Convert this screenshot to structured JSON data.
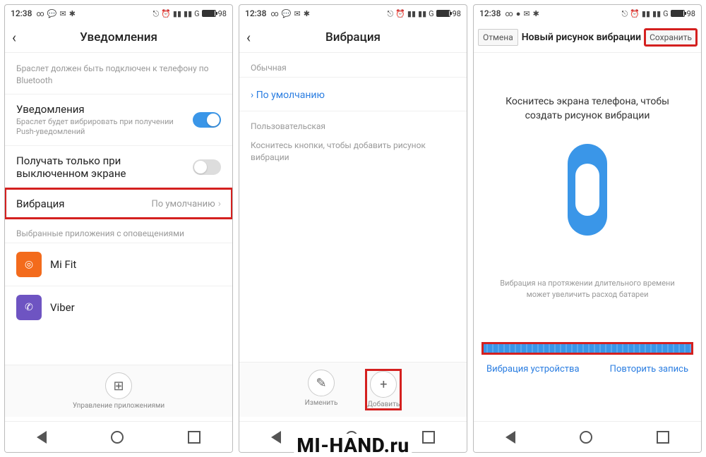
{
  "status": {
    "time": "12:38",
    "battery": "98"
  },
  "screen1": {
    "title": "Уведомления",
    "bt_hint": "Браслет должен быть подключен к телефону по Bluetooth",
    "notif_row": {
      "label": "Уведомления",
      "sub": "Браслет будет вибрировать при получении Push-уведомлений"
    },
    "screen_off_row": {
      "label": "Получать только при выключенном экране"
    },
    "vibration_row": {
      "label": "Вибрация",
      "value": "По умолчанию"
    },
    "apps_header": "Выбранные приложения с оповещениями",
    "apps": {
      "mifit": "Mi Fit",
      "viber": "Viber"
    },
    "manage": "Управление приложениями"
  },
  "screen2": {
    "title": "Вибрация",
    "sect_normal": "Обычная",
    "default_link": "По умолчанию",
    "sect_custom": "Пользовательская",
    "custom_hint": "Коснитесь кнопки, чтобы добавить рисунок вибрации",
    "edit_btn": "Изменить",
    "add_btn": "Добавить"
  },
  "screen3": {
    "cancel": "Отмена",
    "title": "Новый рисунок вибрации",
    "save": "Сохранить",
    "tap_msg": "Коснитесь экрана телефона, чтобы создать рисунок вибрации",
    "warn": "Вибрация на протяжении длительного времени может увеличить расход батареи",
    "device_vib": "Вибрация устройства",
    "repeat": "Повторить запись"
  },
  "watermark": "MI-HAND.ru"
}
